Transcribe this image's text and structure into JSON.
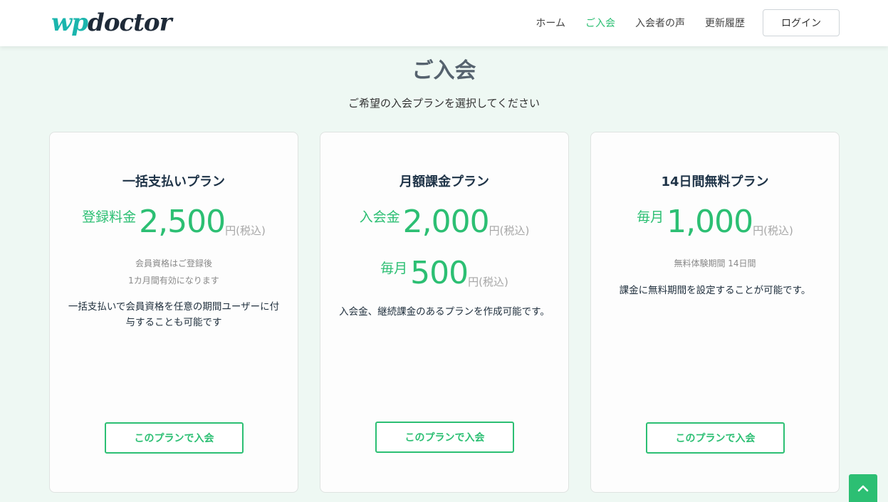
{
  "header": {
    "logo_wp": "wp",
    "logo_rest": "doctor",
    "nav": [
      {
        "label": "ホーム",
        "active": false
      },
      {
        "label": "ご入会",
        "active": true
      },
      {
        "label": "入会者の声",
        "active": false
      },
      {
        "label": "更新履歴",
        "active": false
      }
    ],
    "login_label": "ログイン"
  },
  "page": {
    "title": "ご入会",
    "subtitle": "ご希望の入会プランを選択してください"
  },
  "plans": [
    {
      "title": "一括支払いプラン",
      "prices": [
        {
          "label": "登録料金",
          "amount": "2,500",
          "unit": "円(税込)"
        }
      ],
      "notes": [
        "会員資格はご登録後",
        "1カ月間有効になります"
      ],
      "description": "一括支払いで会員資格を任意の期間ユーザーに付与することも可能です",
      "button_label": "このプランで入会"
    },
    {
      "title": "月額課金プラン",
      "prices": [
        {
          "label": "入会金",
          "amount": "2,000",
          "unit": "円(税込)"
        },
        {
          "label": "毎月",
          "amount": "500",
          "unit": "円(税込)"
        }
      ],
      "notes": [],
      "description": "入会金、継続課金のあるプランを作成可能です。",
      "button_label": "このプランで入会"
    },
    {
      "title": "14日間無料プラン",
      "prices": [
        {
          "label": "毎月",
          "amount": "1,000",
          "unit": "円(税込)"
        }
      ],
      "notes": [
        "無料体験期間 14日間"
      ],
      "description": "課金に無料期間を設定することが可能です。",
      "button_label": "このプランで入会"
    }
  ],
  "colors": {
    "accent": "#2cbf73",
    "logo_accent": "#1bb5ad",
    "background": "#eef8f3"
  },
  "scroll_top_icon": "chevron-up-icon"
}
